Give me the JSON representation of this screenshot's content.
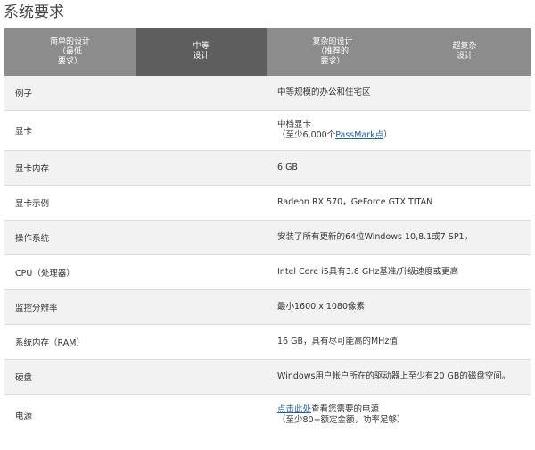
{
  "page": {
    "title": "系统要求"
  },
  "tabs": [
    {
      "label": "简单的设计\n（最低\n要求）",
      "active": false
    },
    {
      "label": "中等\n设计",
      "active": true
    },
    {
      "label": "复杂的设计\n（推荐的\n要求）",
      "active": false
    },
    {
      "label": "超复杂\n设计",
      "active": false
    }
  ],
  "rows": [
    {
      "label": "例子",
      "value": "中等规模的办公和住宅区"
    },
    {
      "label": "显卡",
      "value_line1": "中档显卡",
      "value_line2_prefix": "（至少6,000个",
      "value_line2_link": "PassMark点",
      "value_line2_suffix": "）"
    },
    {
      "label": "显卡内存",
      "value": "6 GB"
    },
    {
      "label": "显卡示例",
      "value": "Radeon RX 570，GeForce GTX TITAN"
    },
    {
      "label": "操作系统",
      "value": "安装了所有更新的64位Windows 10,8.1或7 SP1。"
    },
    {
      "label": "CPU（处理器）",
      "value": "Intel Core i5具有3.6 GHz基准/升级速度或更高"
    },
    {
      "label": "监控分辨率",
      "value": "最小1600 x 1080像素"
    },
    {
      "label": "系统内存（RAM）",
      "value": "16 GB，具有尽可能高的MHz值"
    },
    {
      "label": "硬盘",
      "value": "Windows用户帐户所在的驱动器上至少有20 GB的磁盘空间。"
    },
    {
      "label": "电源",
      "value_line1_link": "点击此处",
      "value_line1_suffix": "查看您需要的电源",
      "value_line2": "（至少80+额定金额，功率足够）"
    }
  ],
  "colors": {
    "tab_bg": "#8c8c8c",
    "tab_active_bg": "#5e5e5e",
    "row_alt_bg": "#f2f2f2",
    "link": "#1f5fa8"
  }
}
